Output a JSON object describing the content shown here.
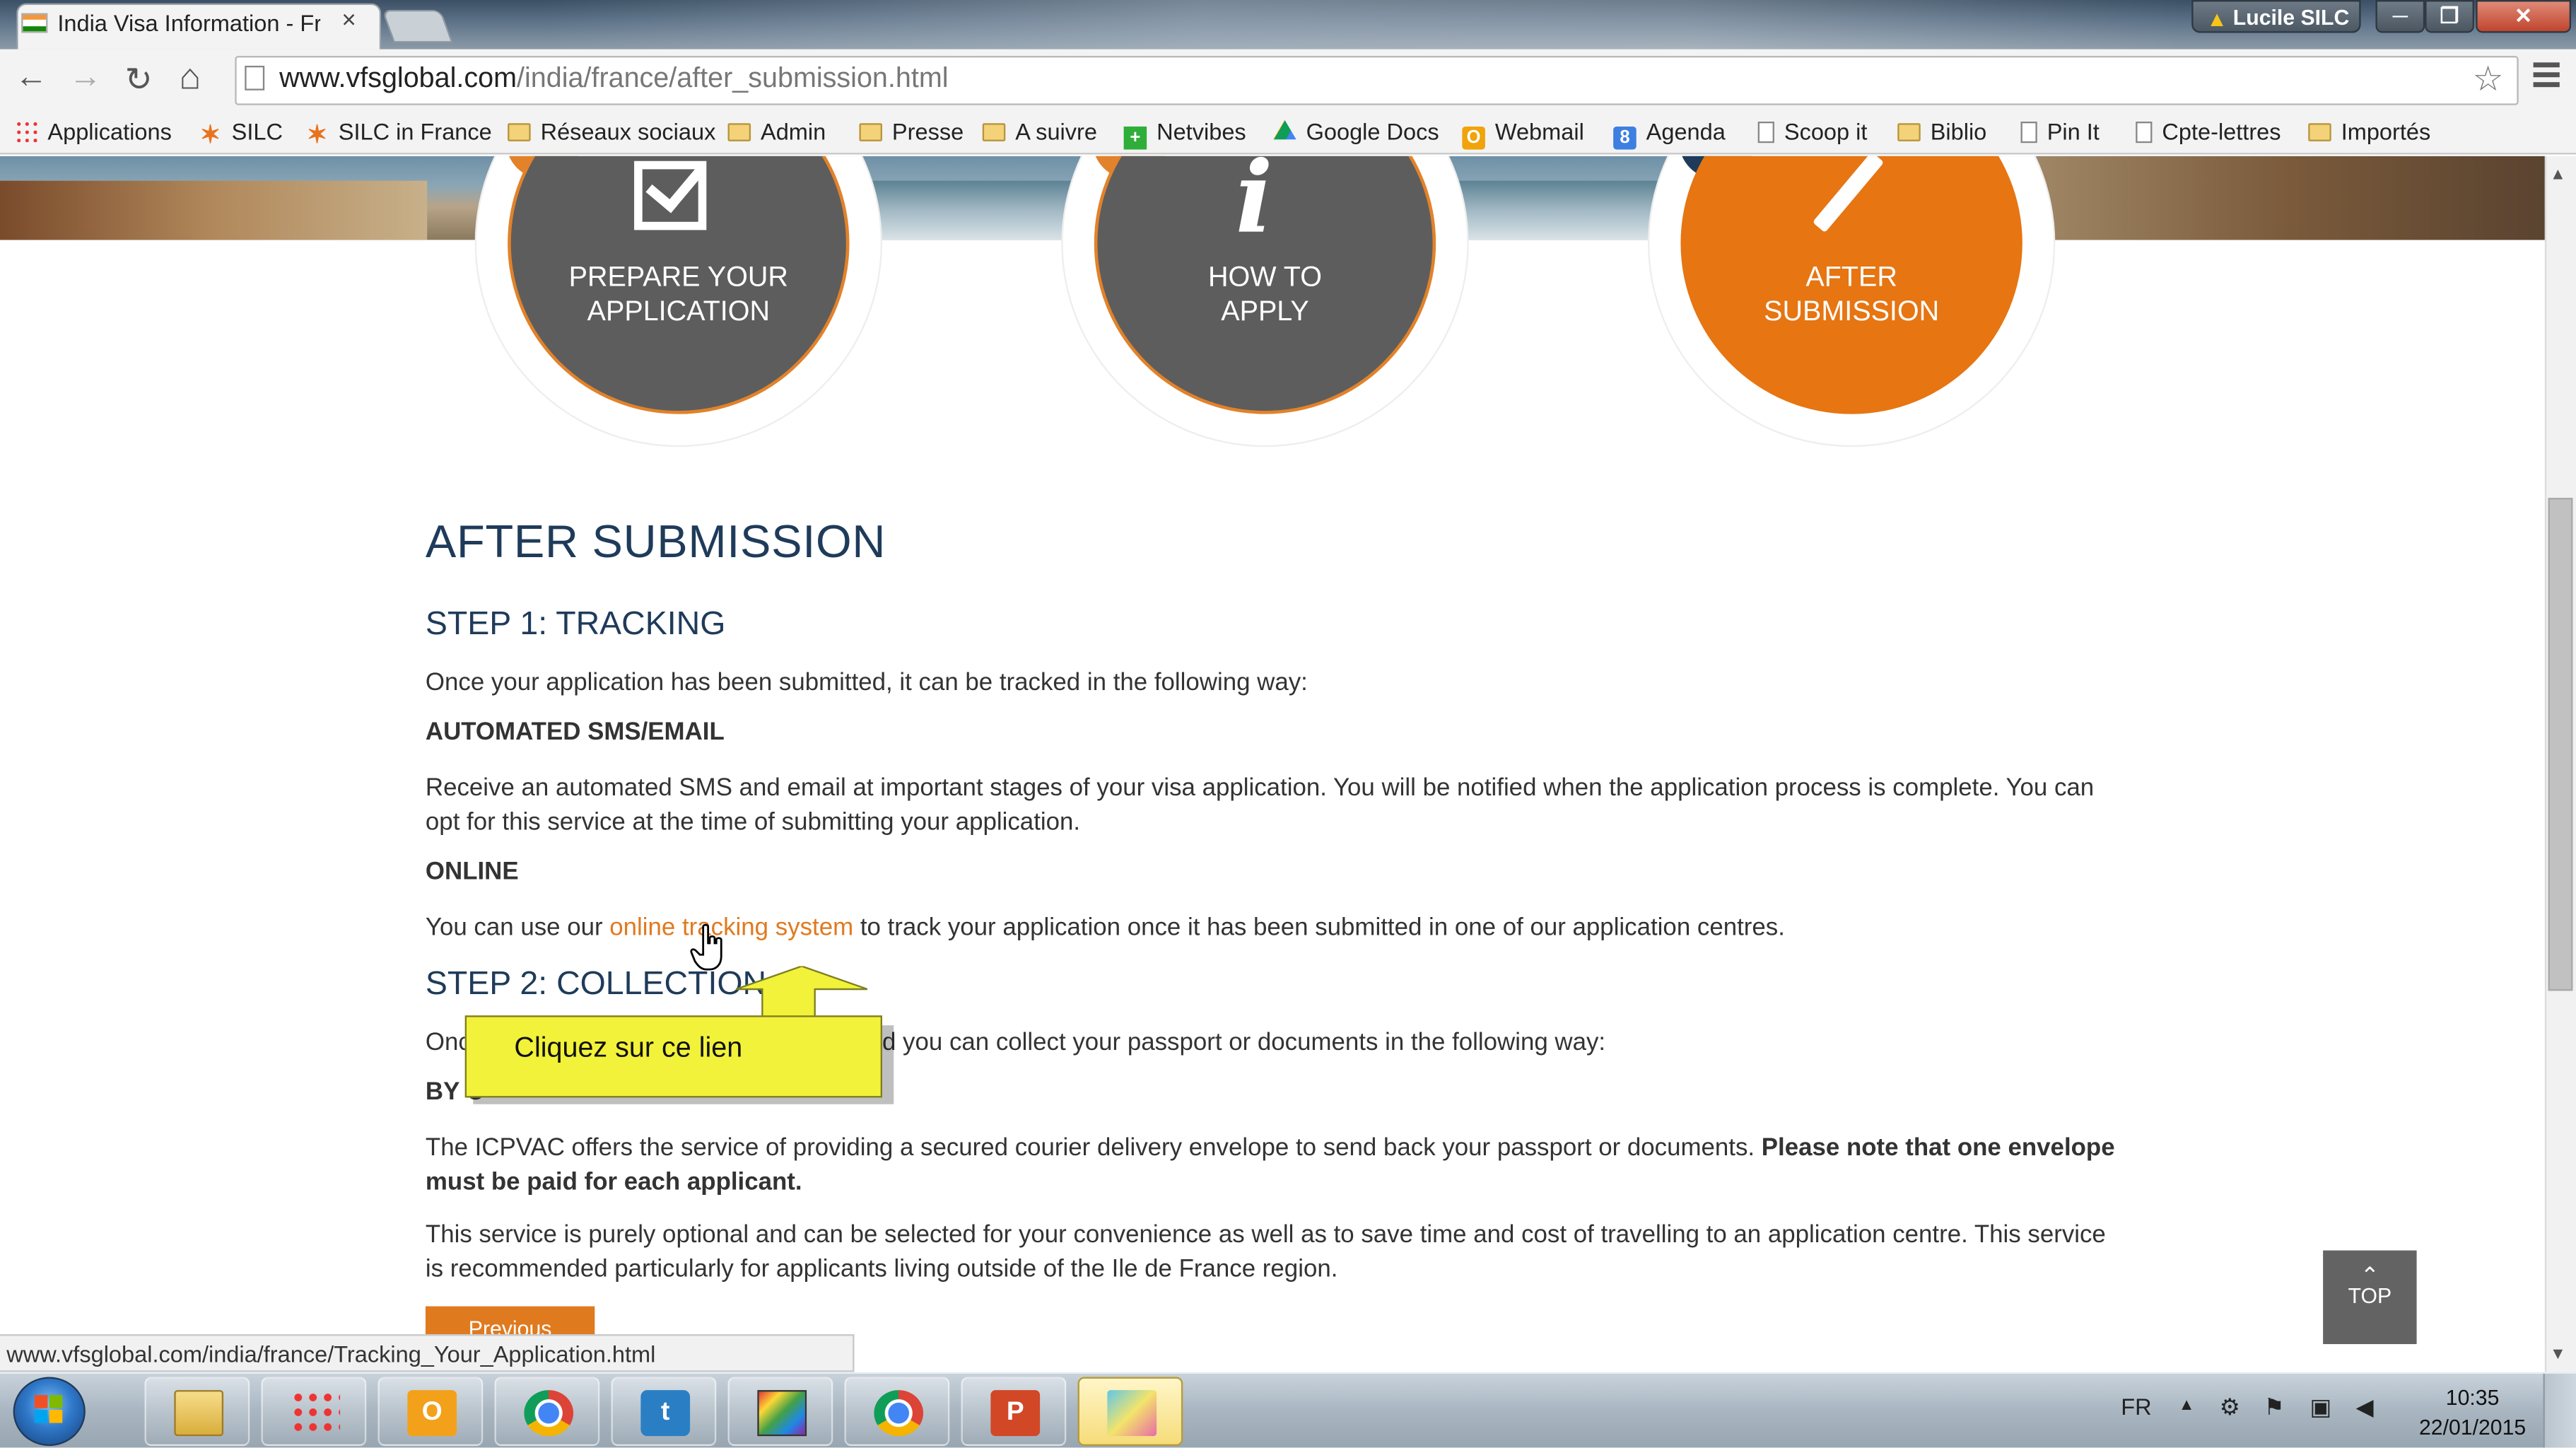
{
  "browser": {
    "tab": {
      "title": "India Visa Information - Fr",
      "close": "×"
    },
    "user": {
      "name": "Lucile SILC"
    },
    "window_buttons": {
      "minimize": "─",
      "maximize": "❐",
      "close": "✕"
    },
    "nav": {
      "back": "←",
      "forward": "→",
      "reload": "↻",
      "home": "⌂"
    },
    "url": {
      "host": "www.vfsglobal.com",
      "path": "/india/france/after_submission.html"
    },
    "bookmarks": [
      {
        "label": "Applications",
        "icon": "apps-grid-icon"
      },
      {
        "label": "SILC",
        "icon": "silc-star-icon"
      },
      {
        "label": "SILC in France",
        "icon": "silc-star-icon"
      },
      {
        "label": "Réseaux sociaux",
        "icon": "folder-icon"
      },
      {
        "label": "Admin",
        "icon": "folder-icon"
      },
      {
        "label": "Presse",
        "icon": "folder-icon"
      },
      {
        "label": "A suivre",
        "icon": "folder-icon"
      },
      {
        "label": "Netvibes",
        "icon": "netvibes-icon"
      },
      {
        "label": "Google Docs",
        "icon": "google-drive-icon"
      },
      {
        "label": "Webmail",
        "icon": "webmail-icon"
      },
      {
        "label": "Agenda",
        "icon": "google-calendar-icon"
      },
      {
        "label": "Scoop it",
        "icon": "page-icon"
      },
      {
        "label": "Biblio",
        "icon": "folder-icon"
      },
      {
        "label": "Pin It",
        "icon": "page-icon"
      },
      {
        "label": "Cpte-lettres",
        "icon": "page-icon"
      },
      {
        "label": "Importés",
        "icon": "folder-icon"
      }
    ],
    "status_url": "www.vfsglobal.com/india/france/Tracking_Your_Application.html"
  },
  "page": {
    "steps": [
      {
        "line1": "PREPARE YOUR",
        "line2": "APPLICATION",
        "icon": "checkbox-icon"
      },
      {
        "line1": "HOW TO",
        "line2": "APPLY",
        "icon": "info-icon"
      },
      {
        "line1": "AFTER",
        "line2": "SUBMISSION",
        "icon": "pencil-icon"
      }
    ],
    "title": "AFTER SUBMISSION",
    "step1": {
      "heading": "STEP 1: TRACKING",
      "intro": "Once your application has been submitted, it can be tracked in the following way:",
      "sms_heading": "AUTOMATED SMS/EMAIL",
      "sms_text": "Receive an automated SMS and email at important stages of your visa application. You will be notified when the application process is complete. You can opt for this service at the time of submitting your application.",
      "online_heading": "ONLINE",
      "online_before": "You can use our ",
      "online_link": "online tracking system",
      "online_after": " to track your application once it has been submitted in one of our application centres."
    },
    "step2": {
      "heading": "STEP 2: COLLECTION",
      "intro_start": "Onc",
      "intro_end": "d you can collect your passport or documents in the following way:",
      "courier_heading": "BY C",
      "courier_text": "The ICPVAC offers the service of providing a secured courier delivery envelope to send back your passport or documents. ",
      "courier_bold": "Please note that one envelope must be paid for each applicant.",
      "optional_text": "This service is purely optional and can be selected for your convenience as well as to save time and cost of travelling to an application centre. This service is recommended particularly for applicants living outside of the Ile de France region."
    },
    "previous_button": "Previous",
    "top_button": {
      "chevron": "⌃",
      "label": "TOP"
    },
    "callout": "Cliquez sur ce lien"
  },
  "taskbar": {
    "apps": [
      {
        "name": "windows-explorer"
      },
      {
        "name": "apps-grid"
      },
      {
        "name": "outlook"
      },
      {
        "name": "chrome"
      },
      {
        "name": "twitter"
      },
      {
        "name": "color-app"
      },
      {
        "name": "chrome"
      },
      {
        "name": "powerpoint"
      },
      {
        "name": "captivate"
      }
    ],
    "language": "FR",
    "time": "10:35",
    "date": "22/01/2015"
  },
  "colors": {
    "accent_orange": "#e07a1f",
    "heading_blue": "#1f3b5a",
    "circle_gray": "#5d5d5d",
    "callout_yellow": "#f2f23a"
  }
}
